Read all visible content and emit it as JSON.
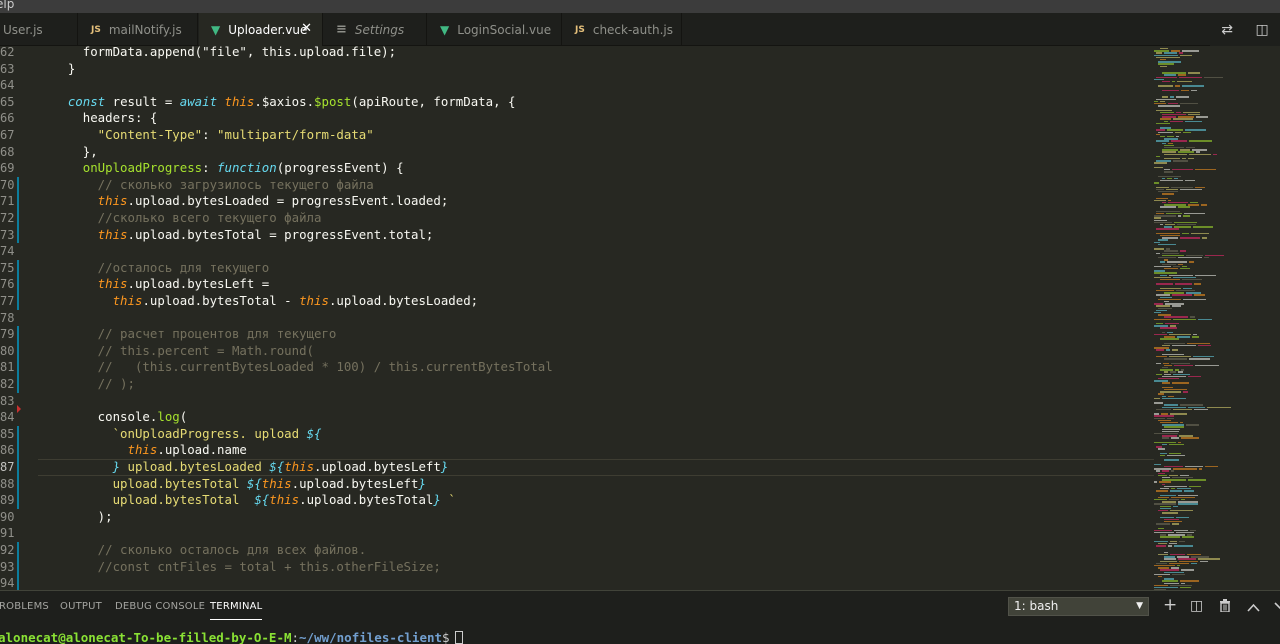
{
  "menu": {
    "partial_label": "elp"
  },
  "tabs": [
    {
      "label": "User.js",
      "icon": "js-icon",
      "icon_text": "",
      "active": false,
      "italic": false
    },
    {
      "label": "mailNotify.js",
      "icon": "js-icon",
      "icon_text": "JS",
      "active": false,
      "italic": false
    },
    {
      "label": "Uploader.vue",
      "icon": "vue-icon",
      "icon_text": "▼",
      "active": true,
      "italic": false
    },
    {
      "label": "Settings",
      "icon": "settings-icon",
      "icon_text": "≡",
      "active": false,
      "italic": true
    },
    {
      "label": "LoginSocial.vue",
      "icon": "vue-icon",
      "icon_text": "▼",
      "active": false,
      "italic": false
    },
    {
      "label": "check-auth.js",
      "icon": "js-icon",
      "icon_text": "JS",
      "active": false,
      "italic": false
    }
  ],
  "tab_close_glyph": "✕",
  "editor_actions": {
    "compare_icon": "⇄",
    "split_icon": "◫"
  },
  "current_line": 87,
  "code_lines": [
    {
      "n": "62",
      "mod": false,
      "tokens": [
        [
          "prop",
          "      formData.append(\"file\", this.upload.file);"
        ]
      ]
    },
    {
      "n": "63",
      "mod": false,
      "tokens": [
        [
          "prop",
          "    }"
        ]
      ]
    },
    {
      "n": "64",
      "mod": false,
      "tokens": []
    },
    {
      "n": "65",
      "mod": false,
      "tokens": [
        [
          "kw",
          "    const "
        ],
        [
          "prop",
          "result = "
        ],
        [
          "kw",
          "await "
        ],
        [
          "this",
          "this"
        ],
        [
          "prop",
          ".$axios."
        ],
        [
          "fn",
          "$post"
        ],
        [
          "prop",
          "(apiRoute, formData, {"
        ]
      ]
    },
    {
      "n": "66",
      "mod": false,
      "tokens": [
        [
          "prop",
          "      headers: {"
        ]
      ]
    },
    {
      "n": "67",
      "mod": false,
      "tokens": [
        [
          "str",
          "        \"Content-Type\""
        ],
        [
          "prop",
          ": "
        ],
        [
          "str",
          "\"multipart/form-data\""
        ]
      ]
    },
    {
      "n": "68",
      "mod": false,
      "tokens": [
        [
          "prop",
          "      },"
        ]
      ]
    },
    {
      "n": "69",
      "mod": false,
      "tokens": [
        [
          "fn",
          "      onUploadProgress"
        ],
        [
          "prop",
          ": "
        ],
        [
          "kw",
          "function"
        ],
        [
          "prop",
          "(progressEvent) {"
        ]
      ]
    },
    {
      "n": "70",
      "mod": true,
      "tokens": [
        [
          "cm",
          "        // сколько загрузилось текущего файла"
        ]
      ]
    },
    {
      "n": "71",
      "mod": true,
      "tokens": [
        [
          "this",
          "        this"
        ],
        [
          "prop",
          ".upload.bytesLoaded = progressEvent.loaded;"
        ]
      ]
    },
    {
      "n": "72",
      "mod": true,
      "tokens": [
        [
          "cm",
          "        //сколько всего текущего файла"
        ]
      ]
    },
    {
      "n": "73",
      "mod": true,
      "tokens": [
        [
          "this",
          "        this"
        ],
        [
          "prop",
          ".upload.bytesTotal = progressEvent.total;"
        ]
      ]
    },
    {
      "n": "74",
      "mod": false,
      "tokens": []
    },
    {
      "n": "75",
      "mod": true,
      "tokens": [
        [
          "cm",
          "        //осталось для текущего"
        ]
      ]
    },
    {
      "n": "76",
      "mod": true,
      "tokens": [
        [
          "this",
          "        this"
        ],
        [
          "prop",
          ".upload.bytesLeft ="
        ]
      ]
    },
    {
      "n": "77",
      "mod": true,
      "tokens": [
        [
          "this",
          "          this"
        ],
        [
          "prop",
          ".upload.bytesTotal - "
        ],
        [
          "this",
          "this"
        ],
        [
          "prop",
          ".upload.bytesLoaded;"
        ]
      ]
    },
    {
      "n": "78",
      "mod": false,
      "tokens": []
    },
    {
      "n": "79",
      "mod": true,
      "tokens": [
        [
          "cm",
          "        // расчет процентов для текущего"
        ]
      ]
    },
    {
      "n": "80",
      "mod": true,
      "tokens": [
        [
          "cm",
          "        // this.percent = Math.round("
        ]
      ]
    },
    {
      "n": "81",
      "mod": true,
      "tokens": [
        [
          "cm",
          "        //   (this.currentBytesLoaded * 100) / this.currentBytesTotal"
        ]
      ]
    },
    {
      "n": "82",
      "mod": true,
      "tokens": [
        [
          "cm",
          "        // );"
        ]
      ]
    },
    {
      "n": "83",
      "mod": false,
      "tokens": []
    },
    {
      "n": "84",
      "mod": false,
      "tokens": [
        [
          "prop",
          "        console."
        ],
        [
          "fn",
          "log"
        ],
        [
          "prop",
          "("
        ]
      ]
    },
    {
      "n": "85",
      "mod": true,
      "tokens": [
        [
          "str",
          "          `onUploadProgress. upload "
        ],
        [
          "kw",
          "${"
        ]
      ]
    },
    {
      "n": "86",
      "mod": true,
      "tokens": [
        [
          "this",
          "            this"
        ],
        [
          "prop",
          ".upload.name"
        ]
      ]
    },
    {
      "n": "87",
      "mod": true,
      "tokens": [
        [
          "kw",
          "          }"
        ],
        [
          "str",
          " upload.bytesLoaded "
        ],
        [
          "kw",
          "${"
        ],
        [
          "this",
          "this"
        ],
        [
          "prop",
          ".upload.bytesLeft"
        ],
        [
          "kw",
          "}"
        ]
      ]
    },
    {
      "n": "88",
      "mod": true,
      "tokens": [
        [
          "str",
          "          upload.bytesTotal "
        ],
        [
          "kw",
          "${"
        ],
        [
          "this",
          "this"
        ],
        [
          "prop",
          ".upload.bytesLeft"
        ],
        [
          "kw",
          "}"
        ]
      ]
    },
    {
      "n": "89",
      "mod": true,
      "tokens": [
        [
          "str",
          "          upload.bytesTotal  "
        ],
        [
          "kw",
          "${"
        ],
        [
          "this",
          "this"
        ],
        [
          "prop",
          ".upload.bytesTotal"
        ],
        [
          "kw",
          "}"
        ],
        [
          "str",
          " `"
        ]
      ]
    },
    {
      "n": "90",
      "mod": false,
      "tokens": [
        [
          "prop",
          "        );"
        ]
      ]
    },
    {
      "n": "91",
      "mod": false,
      "tokens": []
    },
    {
      "n": "92",
      "mod": true,
      "tokens": [
        [
          "cm",
          "        // сколько осталось для всех файлов."
        ]
      ]
    },
    {
      "n": "93",
      "mod": true,
      "tokens": [
        [
          "cm",
          "        //const cntFiles = total + this.otherFileSize;"
        ]
      ]
    },
    {
      "n": "94",
      "mod": true,
      "tokens": []
    }
  ],
  "panel": {
    "tabs": [
      "PROBLEMS",
      "OUTPUT",
      "DEBUG CONSOLE",
      "TERMINAL"
    ],
    "visible_tab_labels": [
      "ROBLEMS",
      "OUTPUT",
      "DEBUG CONSOLE",
      "TERMINAL"
    ],
    "active_tab": "TERMINAL",
    "terminal_select": "1: bash",
    "select_caret": "▼",
    "icons": {
      "add": "+",
      "split": "◫",
      "trash": "🗑",
      "maximize": "⌃"
    }
  },
  "terminal": {
    "user_host": "alonecat@alonecat-To-be-filled-by-O-E-M",
    "separator": ":",
    "path": "~/ww/nofiles-client",
    "dollar": "$"
  },
  "colors": {
    "editor_bg": "#272822",
    "chrome_bg": "#1e1f1c",
    "modified_bar": "#0c7d9d",
    "breakpoint": "#c73131",
    "keyword": "#66d9ef",
    "this": "#fd971f",
    "function": "#a6e22e",
    "string": "#e6db74",
    "comment": "#75715e"
  }
}
